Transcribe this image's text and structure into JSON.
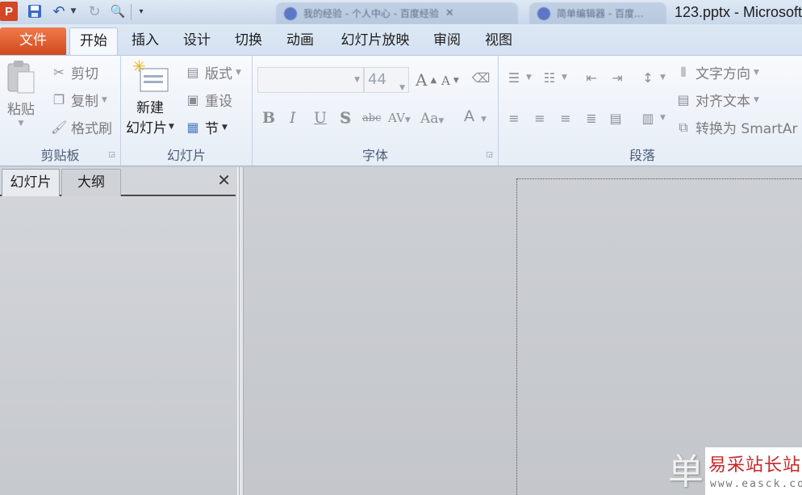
{
  "title_bar": {
    "app_icon_letter": "P",
    "document_title": "123.pptx - Microsoft",
    "browser_tabs": [
      {
        "label": "我的经验 - 个人中心 - 百度经验"
      },
      {
        "label": "简单编辑器 - 百度..."
      }
    ]
  },
  "ribbon_tabs": [
    "文件",
    "开始",
    "插入",
    "设计",
    "切换",
    "动画",
    "幻灯片放映",
    "审阅",
    "视图"
  ],
  "clipboard": {
    "paste": "粘贴",
    "cut": "剪切",
    "copy": "复制",
    "format_painter": "格式刷",
    "group_label": "剪贴板"
  },
  "slides": {
    "new_slide_line1": "新建",
    "new_slide_line2": "幻灯片",
    "layout": "版式",
    "reset": "重设",
    "section": "节",
    "group_label": "幻灯片"
  },
  "font": {
    "font_name": "",
    "font_size": "44",
    "bold": "B",
    "italic": "I",
    "underline": "U",
    "shadow": "S",
    "strikethrough": "abc",
    "spacing": "AV",
    "change_case": "Aa",
    "font_color": "A",
    "grow": "A",
    "shrink": "A",
    "group_label": "字体"
  },
  "paragraph": {
    "text_direction": "文字方向",
    "align_text": "对齐文本",
    "convert_smartart": "转换为 SmartAr",
    "group_label": "段落"
  },
  "left_pane": {
    "tab_slides": "幻灯片",
    "tab_outline": "大纲",
    "close": "✕"
  },
  "watermark": {
    "big_char": "单",
    "site_name": "易采站长站",
    "site_url": "www.easck.com"
  },
  "colors": {
    "file_tab": "#d14a1e",
    "ribbon_bg": "#e6edf6",
    "workspace": "#c6c9ce"
  }
}
